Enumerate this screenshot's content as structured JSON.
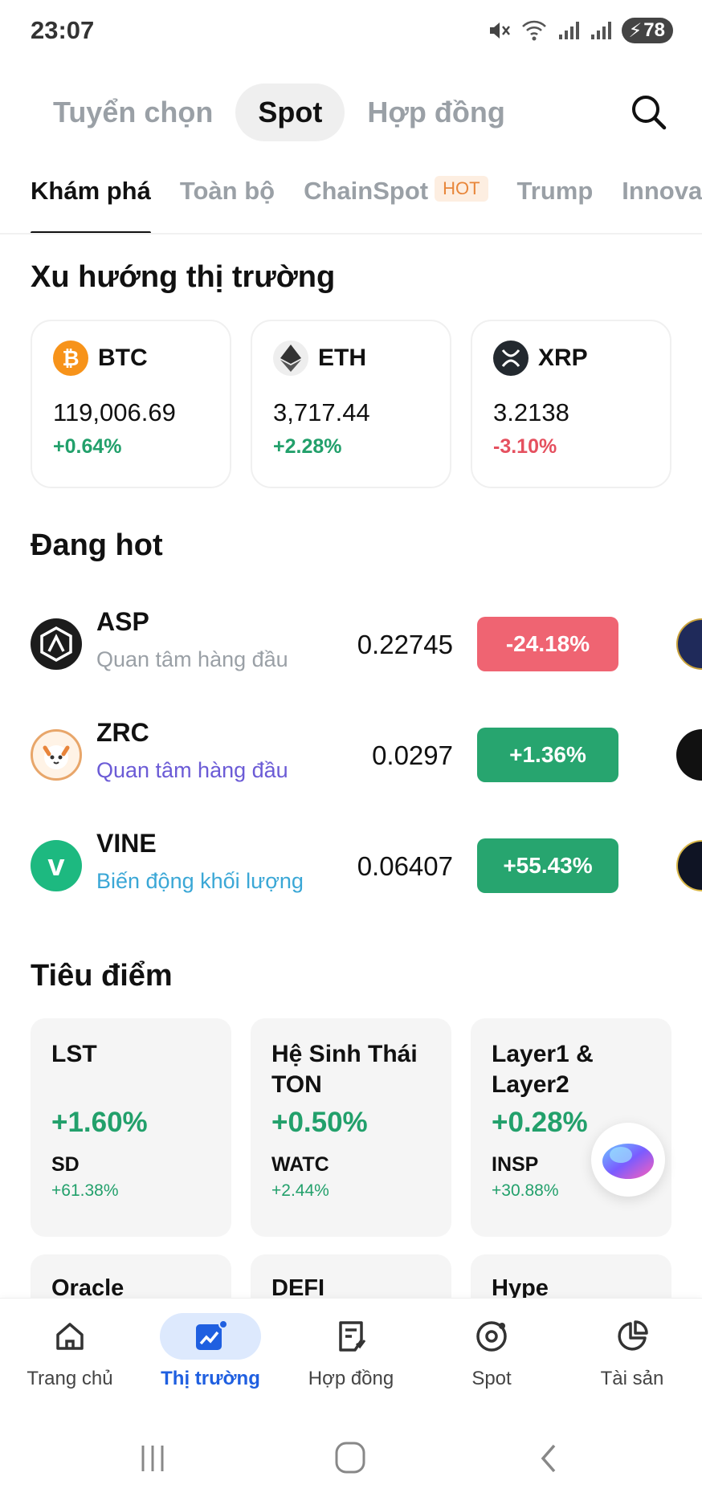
{
  "status_bar": {
    "time": "23:07",
    "battery": "78"
  },
  "top_tabs": [
    {
      "label": "Tuyển chọn",
      "active": false
    },
    {
      "label": "Spot",
      "active": true
    },
    {
      "label": "Hợp đồng",
      "active": false
    }
  ],
  "sub_tabs": [
    {
      "label": "Khám phá",
      "active": true
    },
    {
      "label": "Toàn bộ"
    },
    {
      "label": "ChainSpot",
      "badge": "HOT"
    },
    {
      "label": "Trump"
    },
    {
      "label": "Innovatio"
    }
  ],
  "trend": {
    "title": "Xu hướng thị trường",
    "cards": [
      {
        "symbol": "BTC",
        "price": "119,006.69",
        "change": "+0.64%",
        "icon": "bitcoin-icon",
        "color": "#f7931a"
      },
      {
        "symbol": "ETH",
        "price": "3,717.44",
        "change": "+2.28%",
        "icon": "ethereum-icon",
        "color": "#eeeeee"
      },
      {
        "symbol": "XRP",
        "price": "3.2138",
        "change": "-3.10%",
        "icon": "xrp-icon",
        "color": "#23292f"
      }
    ]
  },
  "hot": {
    "title": "Đang hot",
    "items": [
      {
        "symbol": "ASP",
        "tag": "Quan tâm hàng đầu",
        "tag_color": "#9aa0a6",
        "price": "0.22745",
        "change": "-24.18%"
      },
      {
        "symbol": "ZRC",
        "tag": "Quan tâm hàng đầu",
        "tag_color": "#6b5bd6",
        "price": "0.0297",
        "change": "+1.36%"
      },
      {
        "symbol": "VINE",
        "tag": "Biến động khối lượng",
        "tag_color": "#3aa7d6",
        "price": "0.06407",
        "change": "+55.43%"
      }
    ]
  },
  "focus": {
    "title": "Tiêu điểm",
    "cards": [
      {
        "name": "LST",
        "pct": "+1.60%",
        "coin": "SD",
        "coin_pct": "+61.38%"
      },
      {
        "name": "Hệ Sinh Thái TON",
        "pct": "+0.50%",
        "coin": "WATC",
        "coin_pct": "+2.44%"
      },
      {
        "name": "Layer1 & Layer2",
        "pct": "+0.28%",
        "coin": "INSP",
        "coin_pct": "+30.88%"
      }
    ],
    "more": [
      "Oracle",
      "DEFI",
      "Hype"
    ]
  },
  "bottom_nav": [
    {
      "label": "Trang chủ",
      "icon": "home-icon"
    },
    {
      "label": "Thị trường",
      "icon": "market-chart-icon",
      "active": true
    },
    {
      "label": "Hợp đồng",
      "icon": "contract-icon"
    },
    {
      "label": "Spot",
      "icon": "spot-icon"
    },
    {
      "label": "Tài sản",
      "icon": "assets-pie-icon"
    }
  ],
  "colors": {
    "up": "#22a06b",
    "down": "#e5505f",
    "accent": "#1f5fe0"
  }
}
